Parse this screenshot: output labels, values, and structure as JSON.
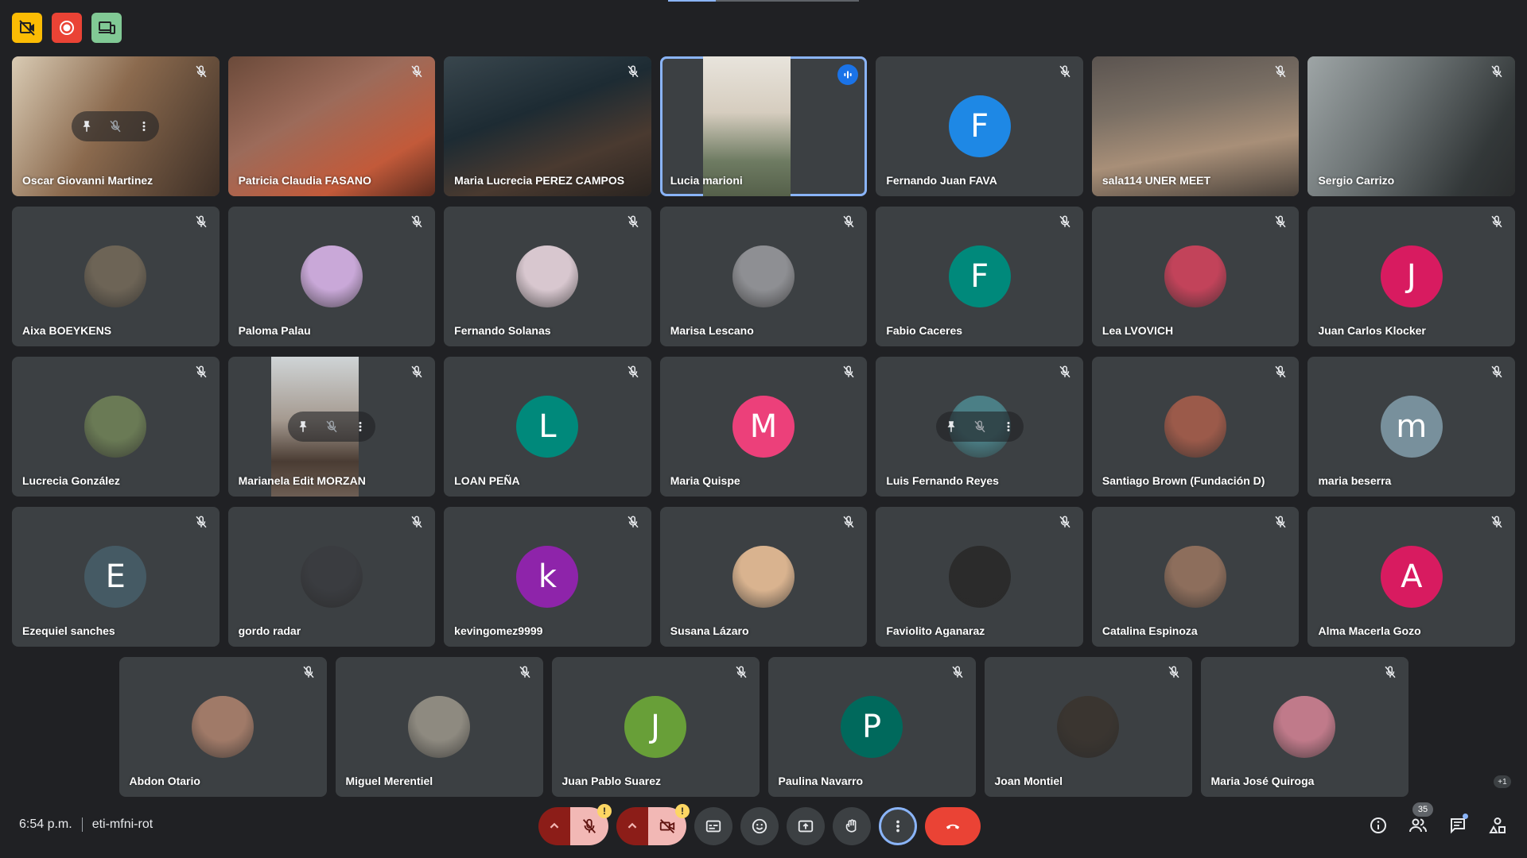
{
  "top_icons": [
    {
      "name": "camera-off-indicator-icon",
      "bg": "#fbbc04"
    },
    {
      "name": "recording-icon",
      "bg": "#ea4335"
    },
    {
      "name": "companion-device-icon",
      "bg": "#81c995"
    }
  ],
  "load_progress": 0.25,
  "rows": [
    [
      {
        "name": "Oscar Giovanni Martinez",
        "kind": "video",
        "bg": "linear-gradient(120deg,#d9cbb4 0%,#8b6a4e 45%,#3d2f26 100%)",
        "hover": true
      },
      {
        "name": "Patricia Claudia FASANO",
        "kind": "video",
        "bg": "linear-gradient(150deg,#6b4a3a 0%,#9c6b5a 40%,#c25a3a 75%,#5a2b1e 100%)"
      },
      {
        "name": "Maria Lucrecia PEREZ CAMPOS",
        "kind": "video",
        "bg": "linear-gradient(160deg,#39464d 0%,#1d2b33 40%,#4a3a30 70%,#2a2420 100%)"
      },
      {
        "name": "Lucia marioni",
        "kind": "narrow-video",
        "bg": "linear-gradient(180deg,#e8e4dc 0%,#d6cdbf 40%,#6e7b62 75%,#55604a 100%)",
        "speaking": true
      },
      {
        "name": "Fernando Juan FAVA",
        "kind": "letter",
        "letter": "F",
        "color": "#1e88e5"
      },
      {
        "name": "sala114 UNER MEET",
        "kind": "video",
        "bg": "linear-gradient(170deg,#5b5450 0%,#7a6f64 35%,#a88f78 65%,#4a423b 100%)"
      },
      {
        "name": "Sergio Carrizo",
        "kind": "video",
        "bg": "linear-gradient(120deg,#9ea5a6 0%,#6d7475 40%,#333839 80%,#2a2c2d 100%)"
      }
    ],
    [
      {
        "name": "Aixa BOEYKENS",
        "kind": "photo",
        "color": "#6d6456"
      },
      {
        "name": "Paloma Palau",
        "kind": "photo",
        "color": "#c9a8d8"
      },
      {
        "name": "Fernando Solanas",
        "kind": "photo",
        "color": "#d8c7cf"
      },
      {
        "name": "Marisa Lescano",
        "kind": "photo",
        "color": "#8e8f93"
      },
      {
        "name": "Fabio Caceres",
        "kind": "letter",
        "letter": "F",
        "color": "#00897b"
      },
      {
        "name": "Lea LVOVICH",
        "kind": "photo",
        "color": "#c2435a"
      },
      {
        "name": "Juan Carlos Klocker",
        "kind": "letter",
        "letter": "J",
        "color": "#d81b60"
      }
    ],
    [
      {
        "name": "Lucrecia González",
        "kind": "photo",
        "color": "#6a7a55"
      },
      {
        "name": "Marianela Edit MORZAN",
        "kind": "narrow-video",
        "bg": "linear-gradient(180deg,#cfd4d6 0%,#a59a90 45%,#4a3c33 75%,#6d5e54 100%)",
        "hover": true
      },
      {
        "name": "LOAN PEÑA",
        "kind": "letter",
        "letter": "L",
        "color": "#00897b"
      },
      {
        "name": "Maria Quispe",
        "kind": "letter",
        "letter": "M",
        "color": "#ec407a"
      },
      {
        "name": "Luis Fernando Reyes",
        "kind": "photo",
        "color": "#4b7f86",
        "hover": true
      },
      {
        "name": "Santiago Brown (Fundación D)",
        "kind": "photo",
        "color": "#9b5a4a"
      },
      {
        "name": "maria beserra",
        "kind": "letter",
        "letter": "m",
        "color": "#78909c"
      }
    ],
    [
      {
        "name": "Ezequiel sanches",
        "kind": "letter",
        "letter": "E",
        "color": "#455a64"
      },
      {
        "name": "gordo radar",
        "kind": "photo",
        "color": "#3a3c40"
      },
      {
        "name": "kevingomez9999",
        "kind": "letter",
        "letter": "k",
        "color": "#8e24aa"
      },
      {
        "name": "Susana Lázaro",
        "kind": "photo",
        "color": "#d9b38f"
      },
      {
        "name": "Faviolito Aganaraz",
        "kind": "photo",
        "color": "#2b2b2b"
      },
      {
        "name": "Catalina Espinoza",
        "kind": "photo",
        "color": "#8d6e5c"
      },
      {
        "name": "Alma Macerla Gozo",
        "kind": "letter",
        "letter": "A",
        "color": "#d81b60"
      }
    ],
    [
      {
        "name": "Abdon Otario",
        "kind": "photo",
        "color": "#a07a68"
      },
      {
        "name": "Miguel Merentiel",
        "kind": "photo",
        "color": "#8e8a80"
      },
      {
        "name": "Juan Pablo Suarez",
        "kind": "letter",
        "letter": "J",
        "color": "#689f38"
      },
      {
        "name": "Paulina Navarro",
        "kind": "letter",
        "letter": "P",
        "color": "#00695c"
      },
      {
        "name": "Joan Montiel",
        "kind": "photo",
        "color": "#3a3530"
      },
      {
        "name": "Maria José Quiroga",
        "kind": "photo",
        "color": "#c07a8a"
      }
    ]
  ],
  "more_count": "+1",
  "bottom": {
    "time": "6:54 p.m.",
    "meeting_code": "eti-mfni-rot"
  },
  "participants_count": "35",
  "controls": [
    "mic-off",
    "camera-off",
    "captions",
    "emoji",
    "present",
    "raise-hand",
    "more-options",
    "leave-call"
  ],
  "right_controls": [
    "meeting-details",
    "people",
    "chat",
    "activities"
  ]
}
